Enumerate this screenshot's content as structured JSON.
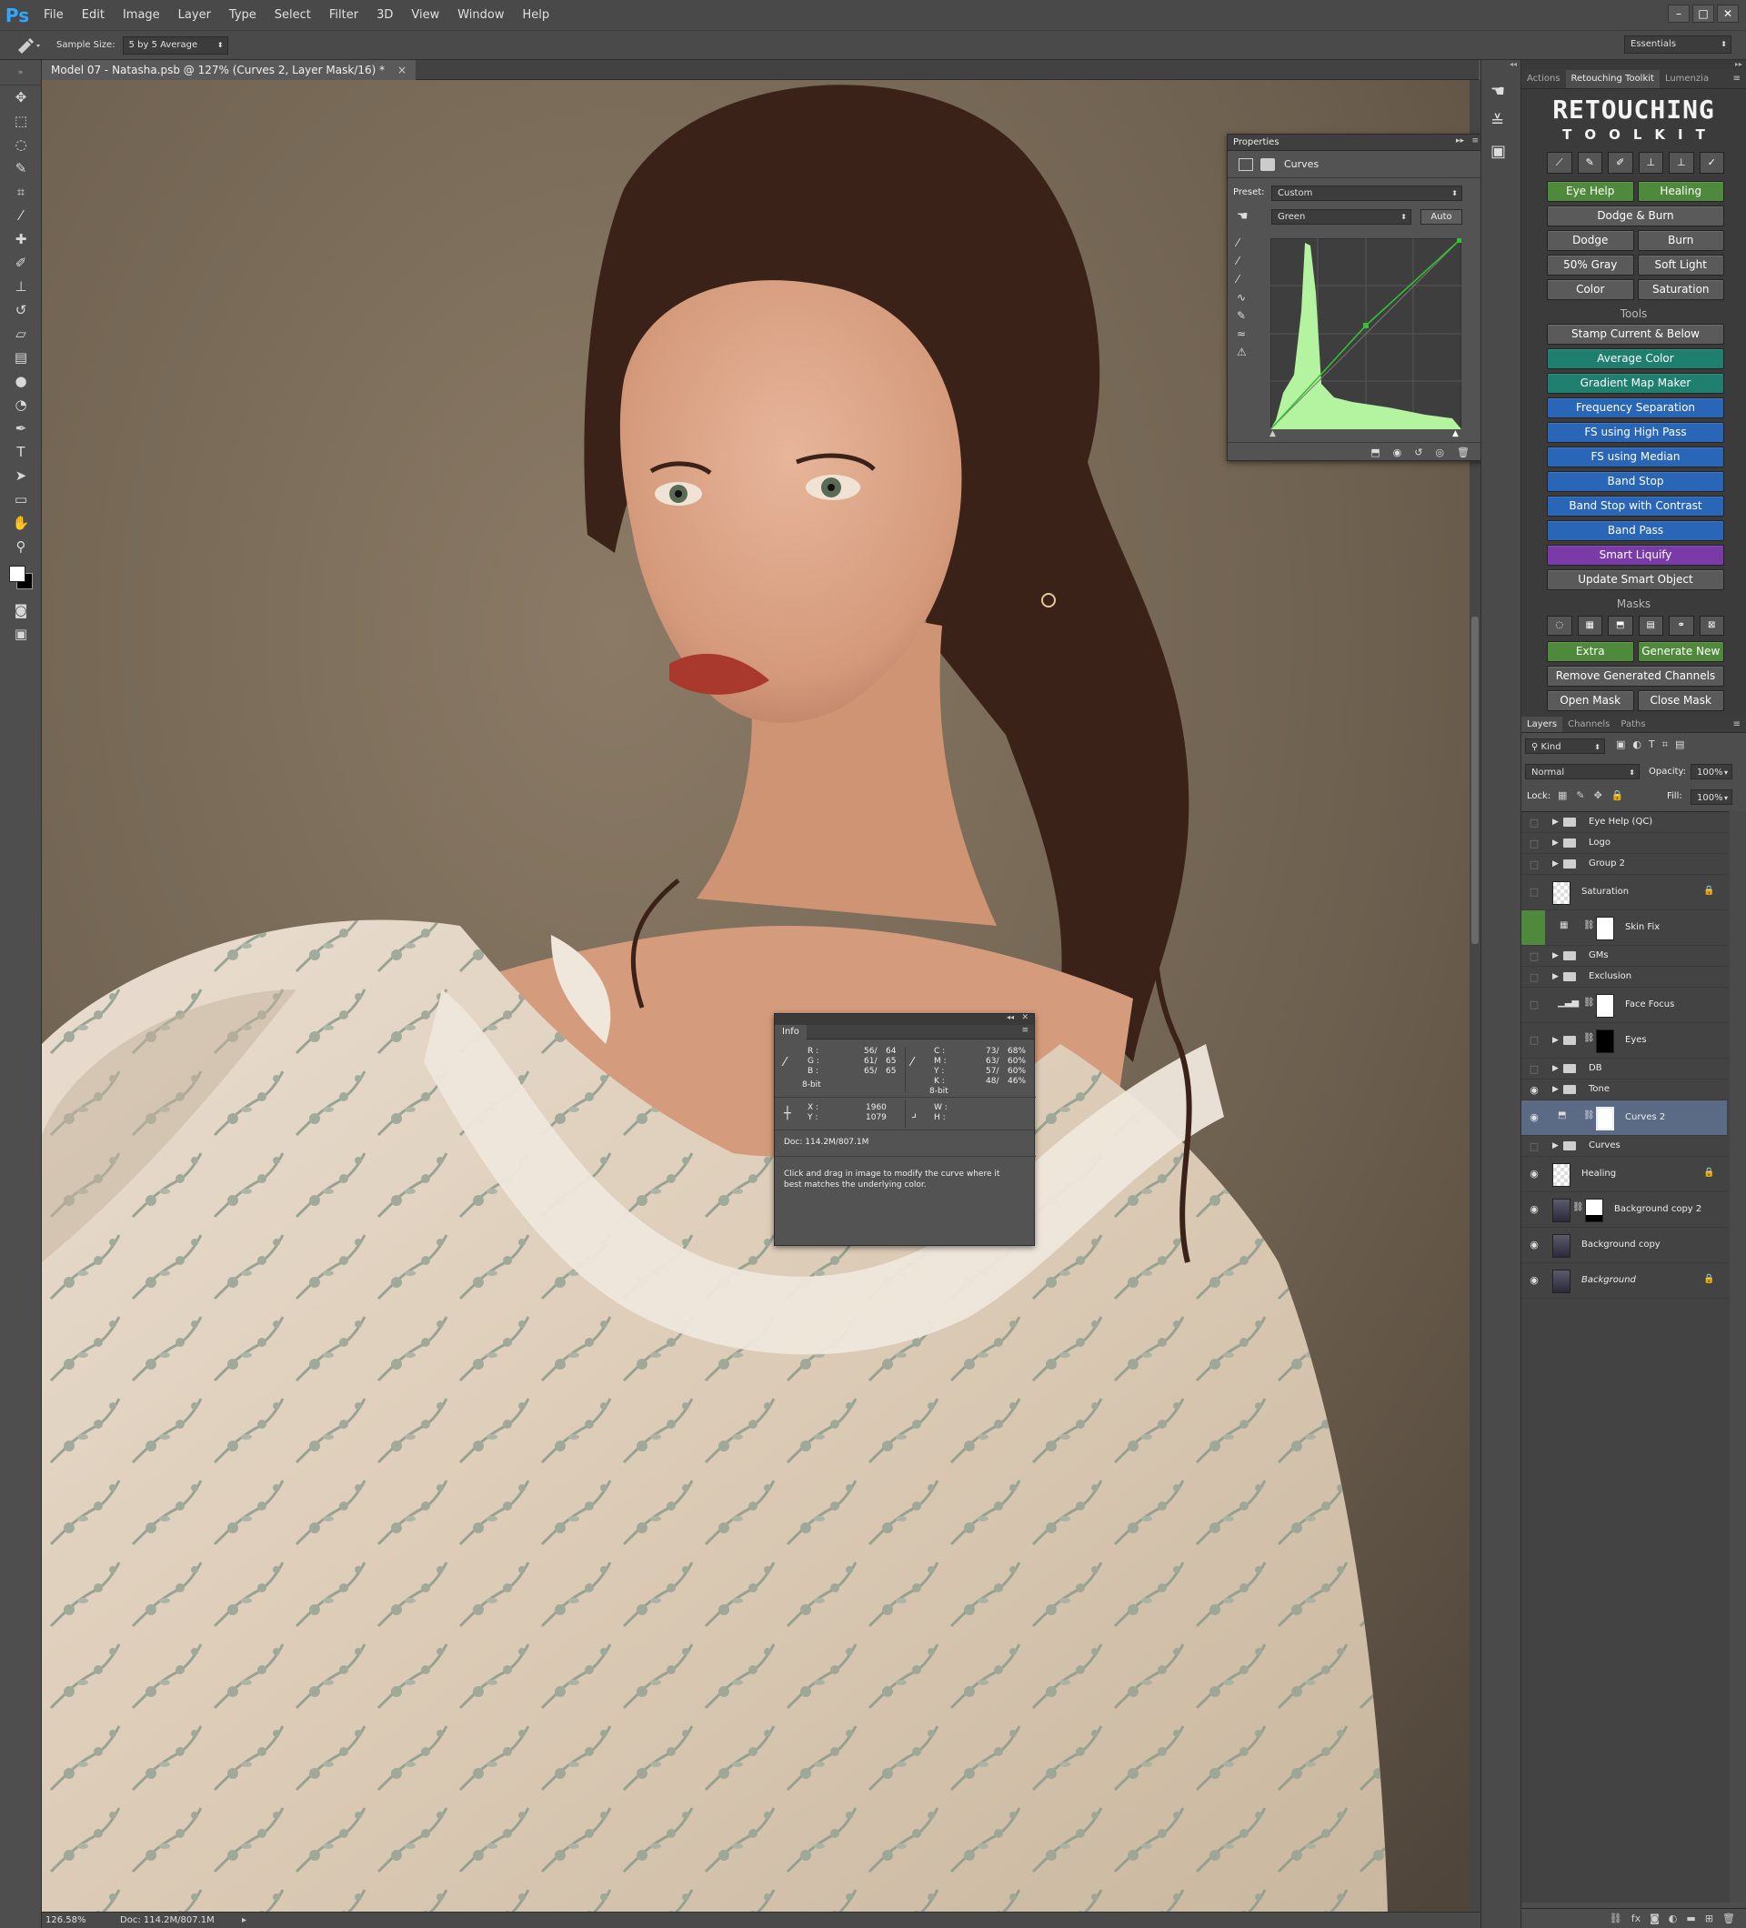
{
  "menubar": {
    "logo": "Ps",
    "items": [
      "File",
      "Edit",
      "Image",
      "Layer",
      "Type",
      "Select",
      "Filter",
      "3D",
      "View",
      "Window",
      "Help"
    ]
  },
  "options": {
    "sample_label": "Sample Size:",
    "sample_value": "5 by 5 Average",
    "workspace": "Essentials"
  },
  "document": {
    "tab_title": "Model 07 - Natasha.psb @ 127% (Curves 2, Layer Mask/16) *",
    "close_glyph": "×"
  },
  "status": {
    "zoom": "126.58%",
    "doc": "Doc: 114.2M/807.1M"
  },
  "properties": {
    "tab": "Properties",
    "title": "Curves",
    "preset_label": "Preset:",
    "preset_value": "Custom",
    "channel": "Green",
    "auto": "Auto"
  },
  "info": {
    "tab": "Info",
    "r_label": "R :",
    "r_val": "56/",
    "r_val2": "64",
    "g_label": "G :",
    "g_val": "61/",
    "g_val2": "65",
    "b_label": "B :",
    "b_val": "65/",
    "b_val2": "65",
    "bit1": "8-bit",
    "c_label": "C :",
    "c_val": "73/",
    "c_val2": "68%",
    "m_label": "M :",
    "m_val": "63/",
    "m_val2": "60%",
    "y_label": "Y :",
    "y_val": "57/",
    "y_val2": "60%",
    "k_label": "K :",
    "k_val": "48/",
    "k_val2": "46%",
    "bit2": "8-bit",
    "x_label": "X :",
    "x_val": "1960",
    "y2_label": "Y :",
    "y2_val": "1079",
    "w_label": "W :",
    "h_label": "H :",
    "doc": "Doc: 114.2M/807.1M",
    "hint": "Click and drag in image to modify the curve where it best matches the underlying color."
  },
  "toolkit": {
    "tabs": [
      "Actions",
      "Retouching Toolkit",
      "Lumenzia"
    ],
    "title": "RETOUCHING",
    "subtitle": "TOOLKIT",
    "eye_help": "Eye Help",
    "healing": "Healing",
    "dodge_burn": "Dodge & Burn",
    "dodge": "Dodge",
    "burn": "Burn",
    "gray": "50% Gray",
    "soft_light": "Soft Light",
    "color": "Color",
    "saturation": "Saturation",
    "tools_title": "Tools",
    "stamp": "Stamp Current & Below",
    "avg_color": "Average Color",
    "grad_map": "Gradient Map Maker",
    "freq_sep": "Frequency Separation",
    "fs_high": "FS using High Pass",
    "fs_median": "FS using Median",
    "band_stop": "Band Stop",
    "band_stop_c": "Band Stop with Contrast",
    "band_pass": "Band Pass",
    "smart_liquify": "Smart Liquify",
    "update_smart": "Update Smart Object",
    "masks_title": "Masks",
    "extra": "Extra",
    "gen_new": "Generate New",
    "remove_gen": "Remove Generated Channels",
    "open_mask": "Open Mask",
    "close_mask": "Close Mask",
    "green": "#4f8a3c",
    "teal": "#1e7f6e",
    "blue": "#2a66b8",
    "purple": "#7a3aa8",
    "gray_btn": "#5a5a5a"
  },
  "layers": {
    "tabs": [
      "Layers",
      "Channels",
      "Paths"
    ],
    "kind": "Kind",
    "blend": "Normal",
    "opacity_label": "Opacity:",
    "opacity": "100%",
    "lock_label": "Lock:",
    "fill_label": "Fill:",
    "fill": "100%",
    "items": [
      {
        "name": "Eye Help (QC)"
      },
      {
        "name": "Logo"
      },
      {
        "name": "Group 2"
      },
      {
        "name": "Saturation"
      },
      {
        "name": "Skin Fix"
      },
      {
        "name": "GMs"
      },
      {
        "name": "Exclusion"
      },
      {
        "name": "Face Focus"
      },
      {
        "name": "Eyes"
      },
      {
        "name": "DB"
      },
      {
        "name": "Tone"
      },
      {
        "name": "Curves 2"
      },
      {
        "name": "Curves"
      },
      {
        "name": "Healing"
      },
      {
        "name": "Background copy 2"
      },
      {
        "name": "Background copy"
      },
      {
        "name": "Background"
      }
    ]
  }
}
